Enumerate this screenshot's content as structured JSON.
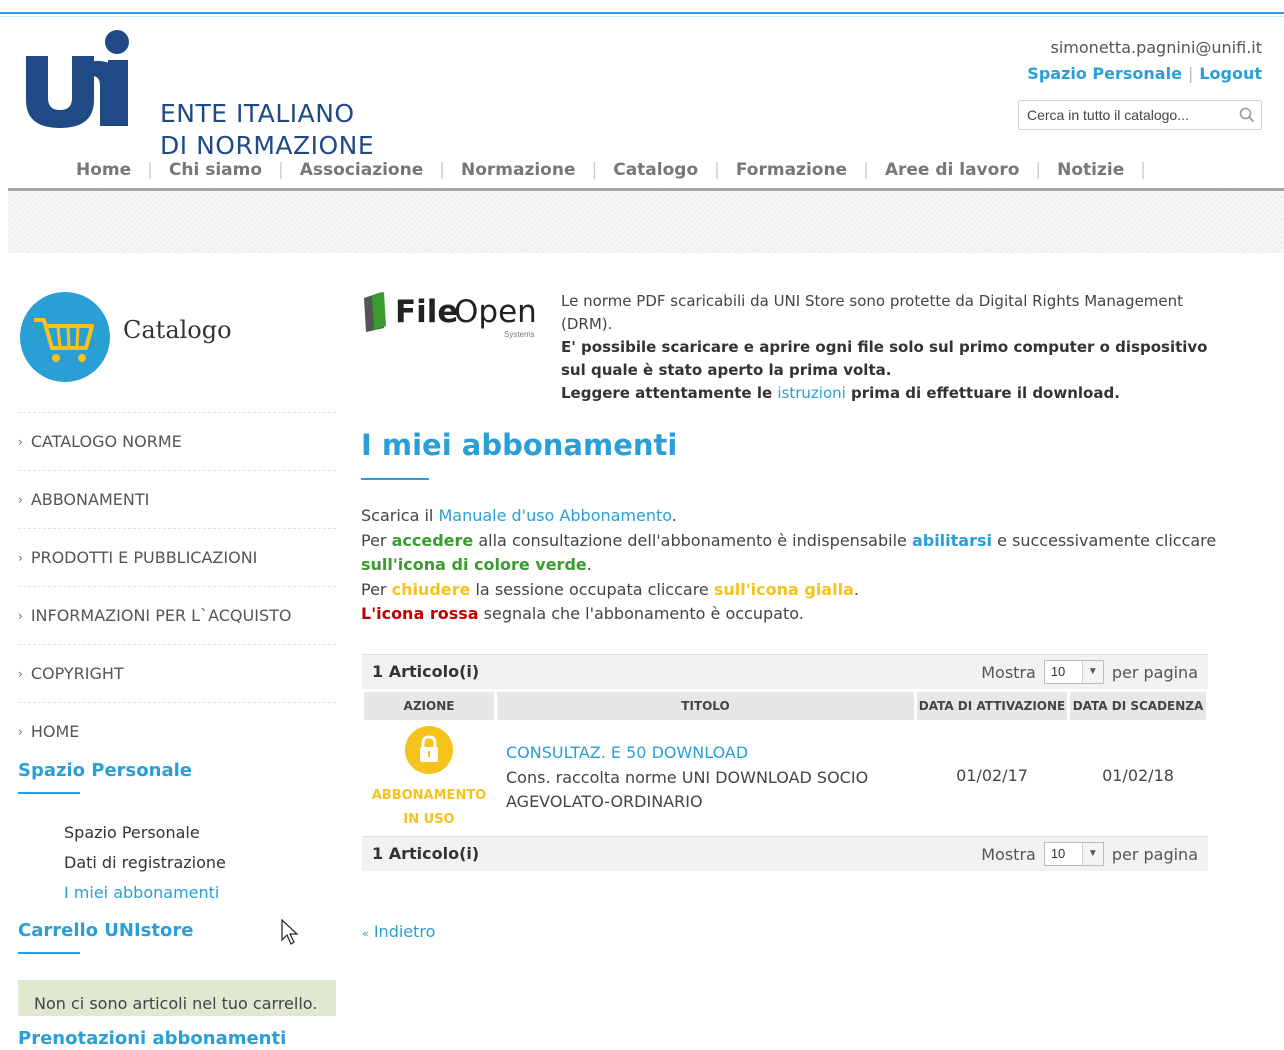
{
  "header": {
    "logo_line1": "ENTE ITALIANO",
    "logo_line2": "DI NORMAZIONE",
    "user_email": "simonetta.pagnini@unifi.it",
    "personal_space_link": "Spazio Personale",
    "logout_link": "Logout",
    "search_placeholder": "Cerca in tutto il catalogo...",
    "icons": {
      "search": "search-icon"
    }
  },
  "nav": {
    "items": [
      "Home",
      "Chi siamo",
      "Associazione",
      "Normazione",
      "Catalogo",
      "Formazione",
      "Aree di lavoro",
      "Notizie"
    ]
  },
  "sidebar": {
    "catalog_title": "Catalogo",
    "catalog_icon": "shopping-cart-icon",
    "items": [
      "CATALOGO NORME",
      "ABBONAMENTI",
      "PRODOTTI E PUBBLICAZIONI",
      "INFORMAZIONI PER L`ACQUISTO",
      "COPYRIGHT",
      "HOME"
    ],
    "personal_section_title": "Spazio Personale",
    "personal_links": [
      "Spazio Personale",
      "Dati di registrazione",
      "I miei abbonamenti"
    ],
    "cart_section_title": "Carrello UNIstore",
    "cart_empty_message": "Non ci sono articoli nel tuo carrello.",
    "bookings_title": "Prenotazioni abbonamenti"
  },
  "drm": {
    "logo_word1": "File",
    "logo_word2": "Open",
    "logo_sub": "Systems",
    "line1": "Le norme PDF scaricabili da UNI Store sono protette da Digital Rights Management (DRM).",
    "line2": "E' possibile scaricare e aprire ogni file solo sul primo computer o dispositivo sul quale è stato aperto la prima volta.",
    "line3_before": "Leggere attentamente le ",
    "line3_link": "istruzioni",
    "line3_after": " prima di effettuare il download."
  },
  "main": {
    "page_title": "I miei abbonamenti",
    "p1_before": "Scarica il ",
    "p1_link": "Manuale d'uso Abbonamento",
    "p1_after": ".",
    "p2_a": "Per ",
    "p2_accedere": "accedere",
    "p2_b": " alla consultazione dell'abbonamento è indispensabile ",
    "p2_abilitarsi": "abilitarsi",
    "p2_c": " e successivamente cliccare ",
    "p2_green": "sull'icona di colore verde",
    "p2_d": ".",
    "p3_a": "Per ",
    "p3_chiudere": "chiudere",
    "p3_b": " la sessione occupata cliccare ",
    "p3_yellow": "sull'icona gialla",
    "p3_c": ".",
    "p4_red": "L'icona rossa",
    "p4_b": " segnala che l'abbonamento è occupato."
  },
  "table": {
    "count_label": "1 Articolo(i)",
    "show_label": "Mostra",
    "per_page_value": "10",
    "per_page_label": "per pagina",
    "columns": [
      "AZIONE",
      "TITOLO",
      "DATA DI ATTIVAZIONE",
      "DATA DI SCADENZA"
    ],
    "rows": [
      {
        "status_line1": "ABBONAMENTO",
        "status_line2": "IN USO",
        "status_icon": "padlock-icon",
        "title_link": "CONSULTAZ. E 50 DOWNLOAD",
        "title_desc": "Cons. raccolta norme UNI DOWNLOAD SOCIO AGEVOLATO-ORDINARIO",
        "activation": "01/02/17",
        "expiry": "01/02/18"
      }
    ]
  },
  "footer": {
    "back_link": "Indietro"
  },
  "colors": {
    "accent": "#2a9fd6",
    "green": "#3a9b2f",
    "yellow": "#f6c21b",
    "red": "#c00000",
    "logo_blue": "#1f4a86"
  }
}
